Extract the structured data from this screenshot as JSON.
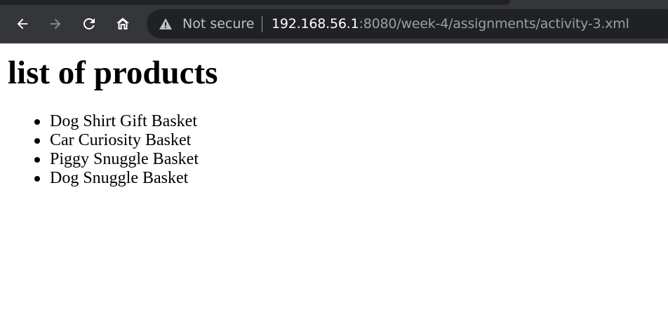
{
  "browser": {
    "security_label": "Not secure",
    "url_host": "192.168.56.1",
    "url_rest": ":8080/week-4/assignments/activity-3.xml",
    "icons": {
      "back": "back-arrow-icon",
      "forward": "forward-arrow-icon",
      "reload": "reload-icon",
      "home": "home-icon",
      "security": "warning-triangle-icon"
    },
    "colors": {
      "toolbar": "#35363a",
      "omnibox": "#202124",
      "url_host": "#ffffff",
      "url_rest": "#9aa0a6"
    }
  },
  "page": {
    "title": "list of products",
    "products": [
      "Dog Shirt Gift Basket",
      "Car Curiosity Basket",
      "Piggy Snuggle Basket",
      "Dog Snuggle Basket"
    ]
  }
}
